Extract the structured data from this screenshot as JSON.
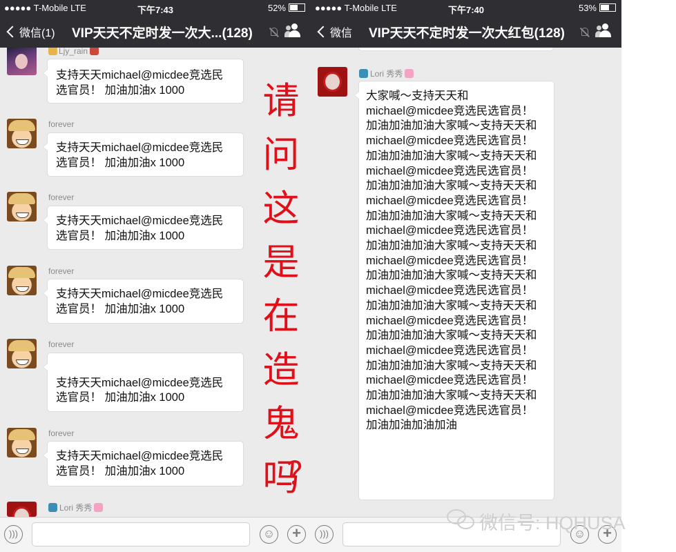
{
  "left_screen": {
    "status": {
      "carrier": "●●●●● T-Mobile  LTE",
      "time": "下午7:43",
      "battery": "52%",
      "battery_level": 0.52
    },
    "nav": {
      "back_label": "微信(1)",
      "title": "VIP天天不定时发一次大...(128)",
      "mute_icon": "mute-bell-icon",
      "members_icon": "group-members-icon"
    },
    "messages": [
      {
        "sender": "Ljy_rain",
        "text": "支持天天michael@micdee竞选民\n选官员！ 加油加油x 1000"
      },
      {
        "sender": "forever",
        "text": "支持天天michael@micdee竞选民\n选官员！ 加油加油x 1000"
      },
      {
        "sender": "forever",
        "text": "支持天天michael@micdee竞选民\n选官员！ 加油加油x 1000"
      },
      {
        "sender": "forever",
        "text": "支持天天michael@micdee竞选民\n选官员！ 加油加油x 1000"
      },
      {
        "sender": "forever",
        "text": "\n支持天天michael@micdee竞选民\n选官员！ 加油加油x 1000"
      },
      {
        "sender": "forever",
        "text": "支持天天michael@micdee竞选民\n选官员！ 加油加油x 1000"
      },
      {
        "sender": "Lori 秀秀",
        "text": ""
      }
    ]
  },
  "right_screen": {
    "status": {
      "carrier": "●●●●● T-Mobile  LTE",
      "time": "下午7:40",
      "battery": "53%",
      "battery_level": 0.53
    },
    "nav": {
      "back_label": "微信",
      "title": "VIP天天不定时发一次大红包(128)",
      "mute_icon": "mute-bell-icon",
      "members_icon": "group-members-icon"
    },
    "messages": [
      {
        "sender": "Lori 秀秀",
        "text": "大家喊～支持天天和\nmichael@micdee竞选民选官员！\n加油加油加油大家喊～支持天天和\nmichael@micdee竞选民选官员！\n加油加油加油大家喊～支持天天和\nmichael@micdee竞选民选官员！\n加油加油加油大家喊～支持天天和\nmichael@micdee竞选民选官员！\n加油加油加油大家喊～支持天天和\nmichael@micdee竞选民选官员！\n加油加油加油大家喊～支持天天和\nmichael@micdee竞选民选官员！\n加油加油加油大家喊～支持天天和\nmichael@micdee竞选民选官员！\n加油加油加油大家喊～支持天天和\nmichael@micdee竞选民选官员！\n加油加油加油大家喊～支持天天和\nmichael@micdee竞选民选官员！\n加油加油加油大家喊～支持天天和\nmichael@micdee竞选民选官员！\n加油加油加油大家喊～支持天天和\nmichael@micdee竞选民选官员！\n加油加油加油加油"
      }
    ]
  },
  "annotation": {
    "text": "请问这是在造鬼吗？",
    "color": "#e0101a"
  },
  "watermark": {
    "text": "微信号: HQHUSA"
  },
  "colors": {
    "nav_bg": "#2f2f33",
    "chat_bg": "#ebebeb",
    "bubble_bg": "#ffffff"
  }
}
